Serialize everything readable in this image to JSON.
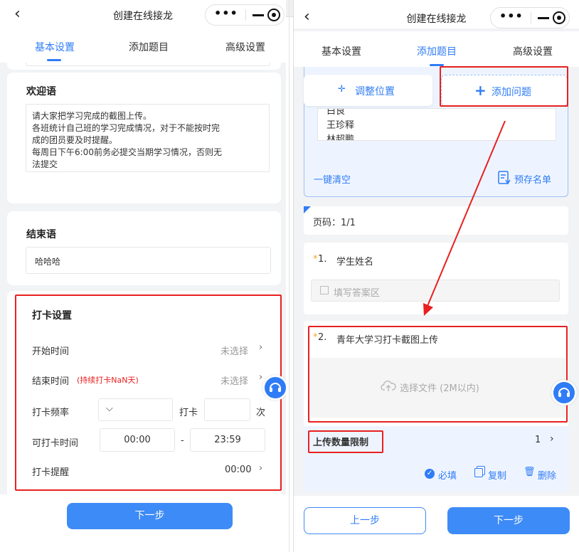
{
  "left": {
    "title": "创建在线接龙",
    "tabs": [
      "基本设置",
      "添加题目",
      "高级设置"
    ],
    "welcome": {
      "heading": "欢迎语",
      "lines": [
        "请大家把学习完成的截图上传。",
        "各班统计自己班的学习完成情况，对于不能按时完",
        "成的团员要及时提醒。",
        "每周日下午6:00前务必提交当期学习情况，否则无",
        "法提交"
      ]
    },
    "ending": {
      "heading": "结束语",
      "value": "哈哈哈"
    },
    "checkin": {
      "heading": "打卡设置",
      "start_label": "开始时间",
      "start_value": "未选择",
      "end_label": "结束时间",
      "end_note": "(持续打卡NaN天)",
      "end_value": "未选择",
      "freq_label": "打卡频率",
      "freq_mid": "打卡",
      "freq_unit": "次",
      "time_label": "可打卡时间",
      "time_from": "00:00",
      "time_dash": "-",
      "time_to": "23:59",
      "remind_label": "打卡提醒",
      "remind_value": "00:00"
    },
    "next_button": "下一步"
  },
  "right": {
    "title": "创建在线接龙",
    "tabs": [
      "基本设置",
      "添加题目",
      "高级设置"
    ],
    "adjust_button": "调整位置",
    "add_question_button": "添加问题",
    "name_list": [
      "白良",
      "王珍释",
      "林超鹏"
    ],
    "clear_label": "一键清空",
    "preset_label": "预存名单",
    "page_label": "页码：1/1",
    "q1": {
      "number": "1.",
      "title": "学生姓名",
      "placeholder": "填写答案区"
    },
    "q2": {
      "number": "2.",
      "title": "青年大学习打卡截图上传",
      "upload_text": "选择文件 (2M以内)"
    },
    "upload_limit_label": "上传数量限制",
    "upload_limit_value": "1",
    "required_label": "必填",
    "copy_label": "复制",
    "delete_label": "删除",
    "prev_button": "上一步",
    "next_button": "下一步"
  },
  "colors": {
    "accent": "#2f7cf6",
    "highlight": "#e82020",
    "required_star": "#f5a623"
  }
}
